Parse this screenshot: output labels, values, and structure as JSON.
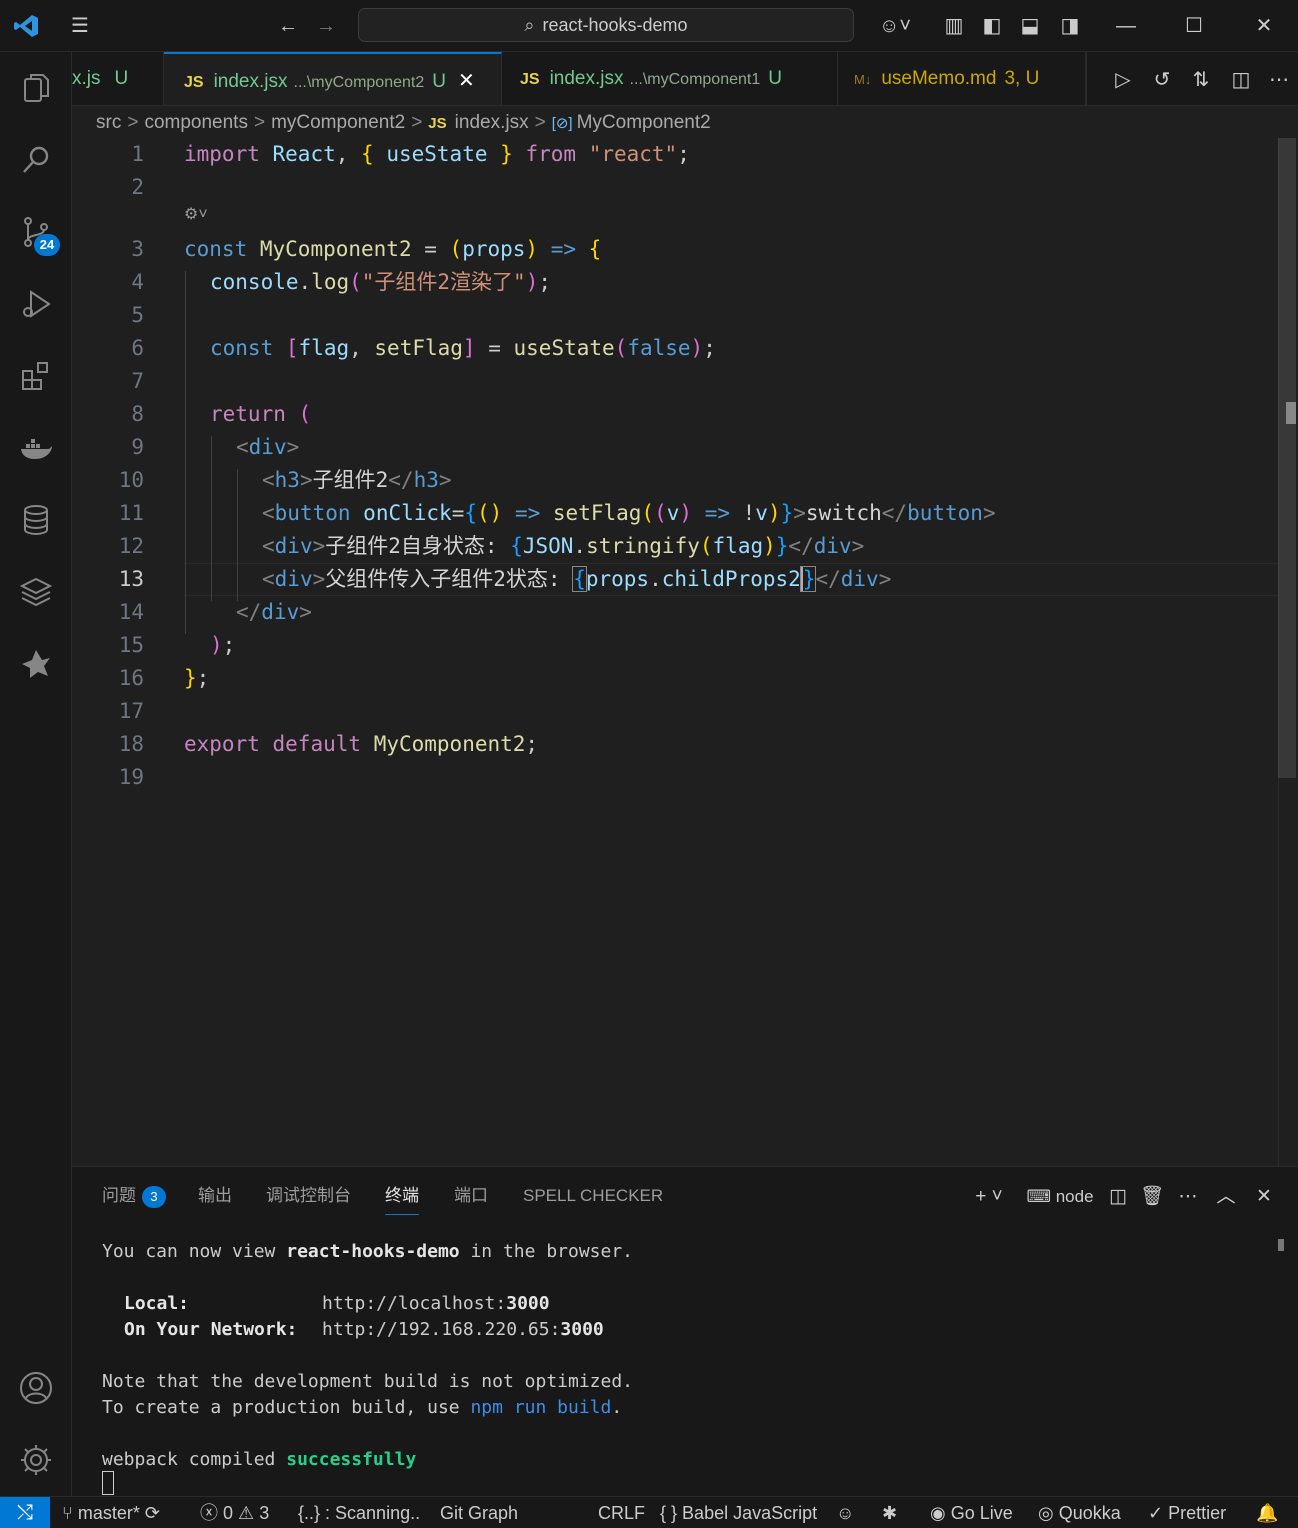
{
  "window": {
    "title": "react-hooks-demo"
  },
  "tabs": [
    {
      "label": "x.js",
      "status": "U"
    },
    {
      "label": "index.jsx",
      "path": "...\\myComponent2",
      "status": "U",
      "active": true
    },
    {
      "label": "index.jsx",
      "path": "...\\myComponent1",
      "status": "U"
    },
    {
      "label": "useMemo.md",
      "status": "3, U"
    }
  ],
  "tab_js_badge": "JS",
  "breadcrumb": [
    "src",
    "components",
    "myComponent2",
    "index.jsx",
    "MyComponent2"
  ],
  "activity": {
    "scm_badge": "24"
  },
  "editor": {
    "line_numbers": [
      "1",
      "2",
      "3",
      "4",
      "5",
      "6",
      "7",
      "8",
      "9",
      "10",
      "11",
      "12",
      "13",
      "14",
      "15",
      "16",
      "17",
      "18",
      "19"
    ],
    "current_line": "13",
    "lines": {
      "l1": {
        "import": "import",
        "react": "React",
        "usestate": "useState",
        "from": "from",
        "str": "\"react\""
      },
      "l3": {
        "const": "const",
        "name": "MyComponent2",
        "eq": " = ",
        "props": "props",
        "arrow": "=>"
      },
      "l4": {
        "console": "console",
        "log": "log",
        "str": "\"子组件2渲染了\""
      },
      "l6": {
        "const": "const",
        "flag": "flag",
        "setflag": "setFlag",
        "usestate": "useState",
        "false": "false"
      },
      "l8": {
        "return": "return"
      },
      "l9": {
        "tag": "div"
      },
      "l10": {
        "tag": "h3",
        "text": "子组件2"
      },
      "l11": {
        "tag": "button",
        "attr": "onClick",
        "fn": "setFlag",
        "v": "v",
        "text": "switch"
      },
      "l12": {
        "tag": "div",
        "text": "子组件2自身状态: ",
        "json": "JSON",
        "stringify": "stringify",
        "flag": "flag"
      },
      "l13": {
        "tag": "div",
        "text": "父组件传入子组件2状态: ",
        "props": "props",
        "child": "childProps2"
      },
      "l18": {
        "export": "export",
        "default": "default",
        "name": "MyComponent2"
      }
    }
  },
  "panel": {
    "tabs": [
      "问题",
      "输出",
      "调试控制台",
      "终端",
      "端口",
      "SPELL CHECKER"
    ],
    "problems_count": "3",
    "active_tab": "终端",
    "terminal_profile": "node",
    "terminal": {
      "line1_a": "You can now view ",
      "line1_b": "react-hooks-demo",
      "line1_c": " in the browser.",
      "local_label": "Local:",
      "local_url_a": "http://localhost:",
      "local_url_b": "3000",
      "network_label": "On Your Network:",
      "network_url_a": "http://192.168.220.65:",
      "network_url_b": "3000",
      "note1": "Note that the development build is not optimized.",
      "note2_a": "To create a production build, use ",
      "note2_b": "npm run build",
      "note2_c": ".",
      "compiled_a": "webpack compiled ",
      "compiled_b": "successfully"
    }
  },
  "statusbar": {
    "branch": "master*",
    "errors": "0",
    "warnings": "3",
    "scanning": "{..} : Scanning..",
    "git_graph": "Git Graph",
    "eol": "CRLF",
    "language": "Babel JavaScript",
    "go_live": "Go Live",
    "quokka": "Quokka",
    "prettier": "Prettier"
  },
  "colors": {
    "accent": "#0078d4",
    "keyword": "#569cd6",
    "control": "#c586c0",
    "string": "#ce9178",
    "function": "#dcdcaa",
    "variable": "#9cdcfe"
  }
}
